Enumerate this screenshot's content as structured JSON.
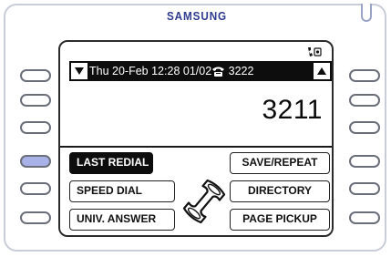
{
  "brand": "SAMSUNG",
  "status_bar": {
    "date": "Thu 20-Feb",
    "time": "12:28",
    "line": "01/02",
    "extension": "3222"
  },
  "display_number": "3211",
  "softkeys": {
    "left": [
      {
        "label": "LAST REDIAL",
        "selected": true
      },
      {
        "label": "SPEED DIAL",
        "selected": false
      },
      {
        "label": "UNIV. ANSWER",
        "selected": false
      }
    ],
    "right": [
      {
        "label": "SAVE/REPEAT",
        "selected": false
      },
      {
        "label": "DIRECTORY",
        "selected": false
      },
      {
        "label": "PAGE PICKUP",
        "selected": false
      }
    ]
  },
  "colors": {
    "brand_blue": "#2f3a8f",
    "active_button": "#a9b2e8",
    "lcd_black": "#0d0d0d"
  },
  "icons": [
    "scroll-up-arrow-icon",
    "scroll-down-arrow-icon",
    "phone-icon",
    "handset-icon",
    "handset-status-icon"
  ]
}
